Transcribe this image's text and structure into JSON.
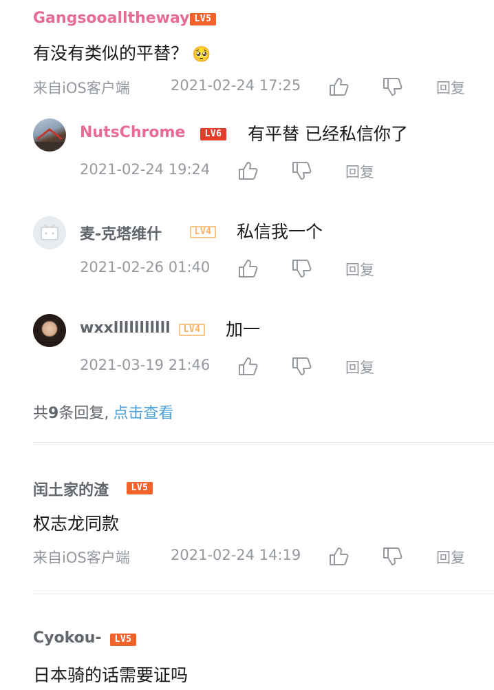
{
  "comments": [
    {
      "username": "Gangsooalltheway",
      "level": "LV5",
      "content": "有没有类似的平替？",
      "emoji": "🥺",
      "source": "来自iOS客户端",
      "time": "2021-02-24 17:25",
      "reply_label": "回复",
      "replies": [
        {
          "username": "NutsChrome",
          "level": "LV6",
          "content": "有平替 已经私信你了",
          "time": "2021-02-24 19:24",
          "reply_label": "回复"
        },
        {
          "username": "麦-克塔维什",
          "level": "LV4",
          "content": "私信我一个",
          "time": "2021-02-26 01:40",
          "reply_label": "回复"
        },
        {
          "username": "wxxlllllllllll",
          "level": "LV4",
          "content": "加一",
          "time": "2021-03-19 21:46",
          "reply_label": "回复"
        }
      ],
      "more_prefix": "共",
      "more_count": "9",
      "more_suffix": "条回复,",
      "more_link": "点击查看"
    },
    {
      "username": "闰土家的渣",
      "level": "LV5",
      "content": "权志龙同款",
      "source": "来自iOS客户端",
      "time": "2021-02-24 14:19",
      "reply_label": "回复"
    },
    {
      "username": "Cyokou-",
      "level": "LV5",
      "content": "日本骑的话需要证吗"
    }
  ],
  "icons": {
    "like": "thumbs-up-icon",
    "dislike": "thumbs-down-icon"
  },
  "colors": {
    "vip_name": "#e66c93",
    "link": "#4a9fd8",
    "lv5": "#f2632b",
    "lv6": "#e33e2c",
    "lv4": "#f5b067"
  }
}
